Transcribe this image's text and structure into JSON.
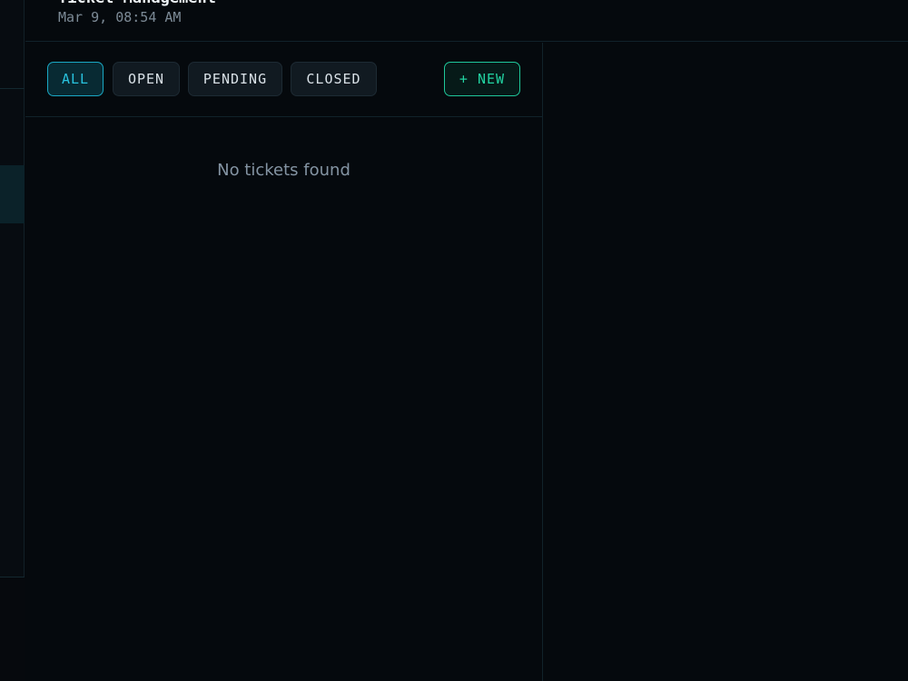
{
  "header": {
    "title": "Ticket Management",
    "timestamp": "Mar 9, 08:54 AM"
  },
  "filters": [
    {
      "label": "ALL",
      "active": true
    },
    {
      "label": "OPEN",
      "active": false
    },
    {
      "label": "PENDING",
      "active": false
    },
    {
      "label": "CLOSED",
      "active": false
    }
  ],
  "new_button": {
    "label": "+ NEW"
  },
  "list": {
    "empty_message": "No tickets found"
  },
  "colors": {
    "background": "#05090d",
    "accent_cyan": "#28c3df",
    "accent_green": "#22d3a1",
    "muted_text": "#8494a3"
  }
}
